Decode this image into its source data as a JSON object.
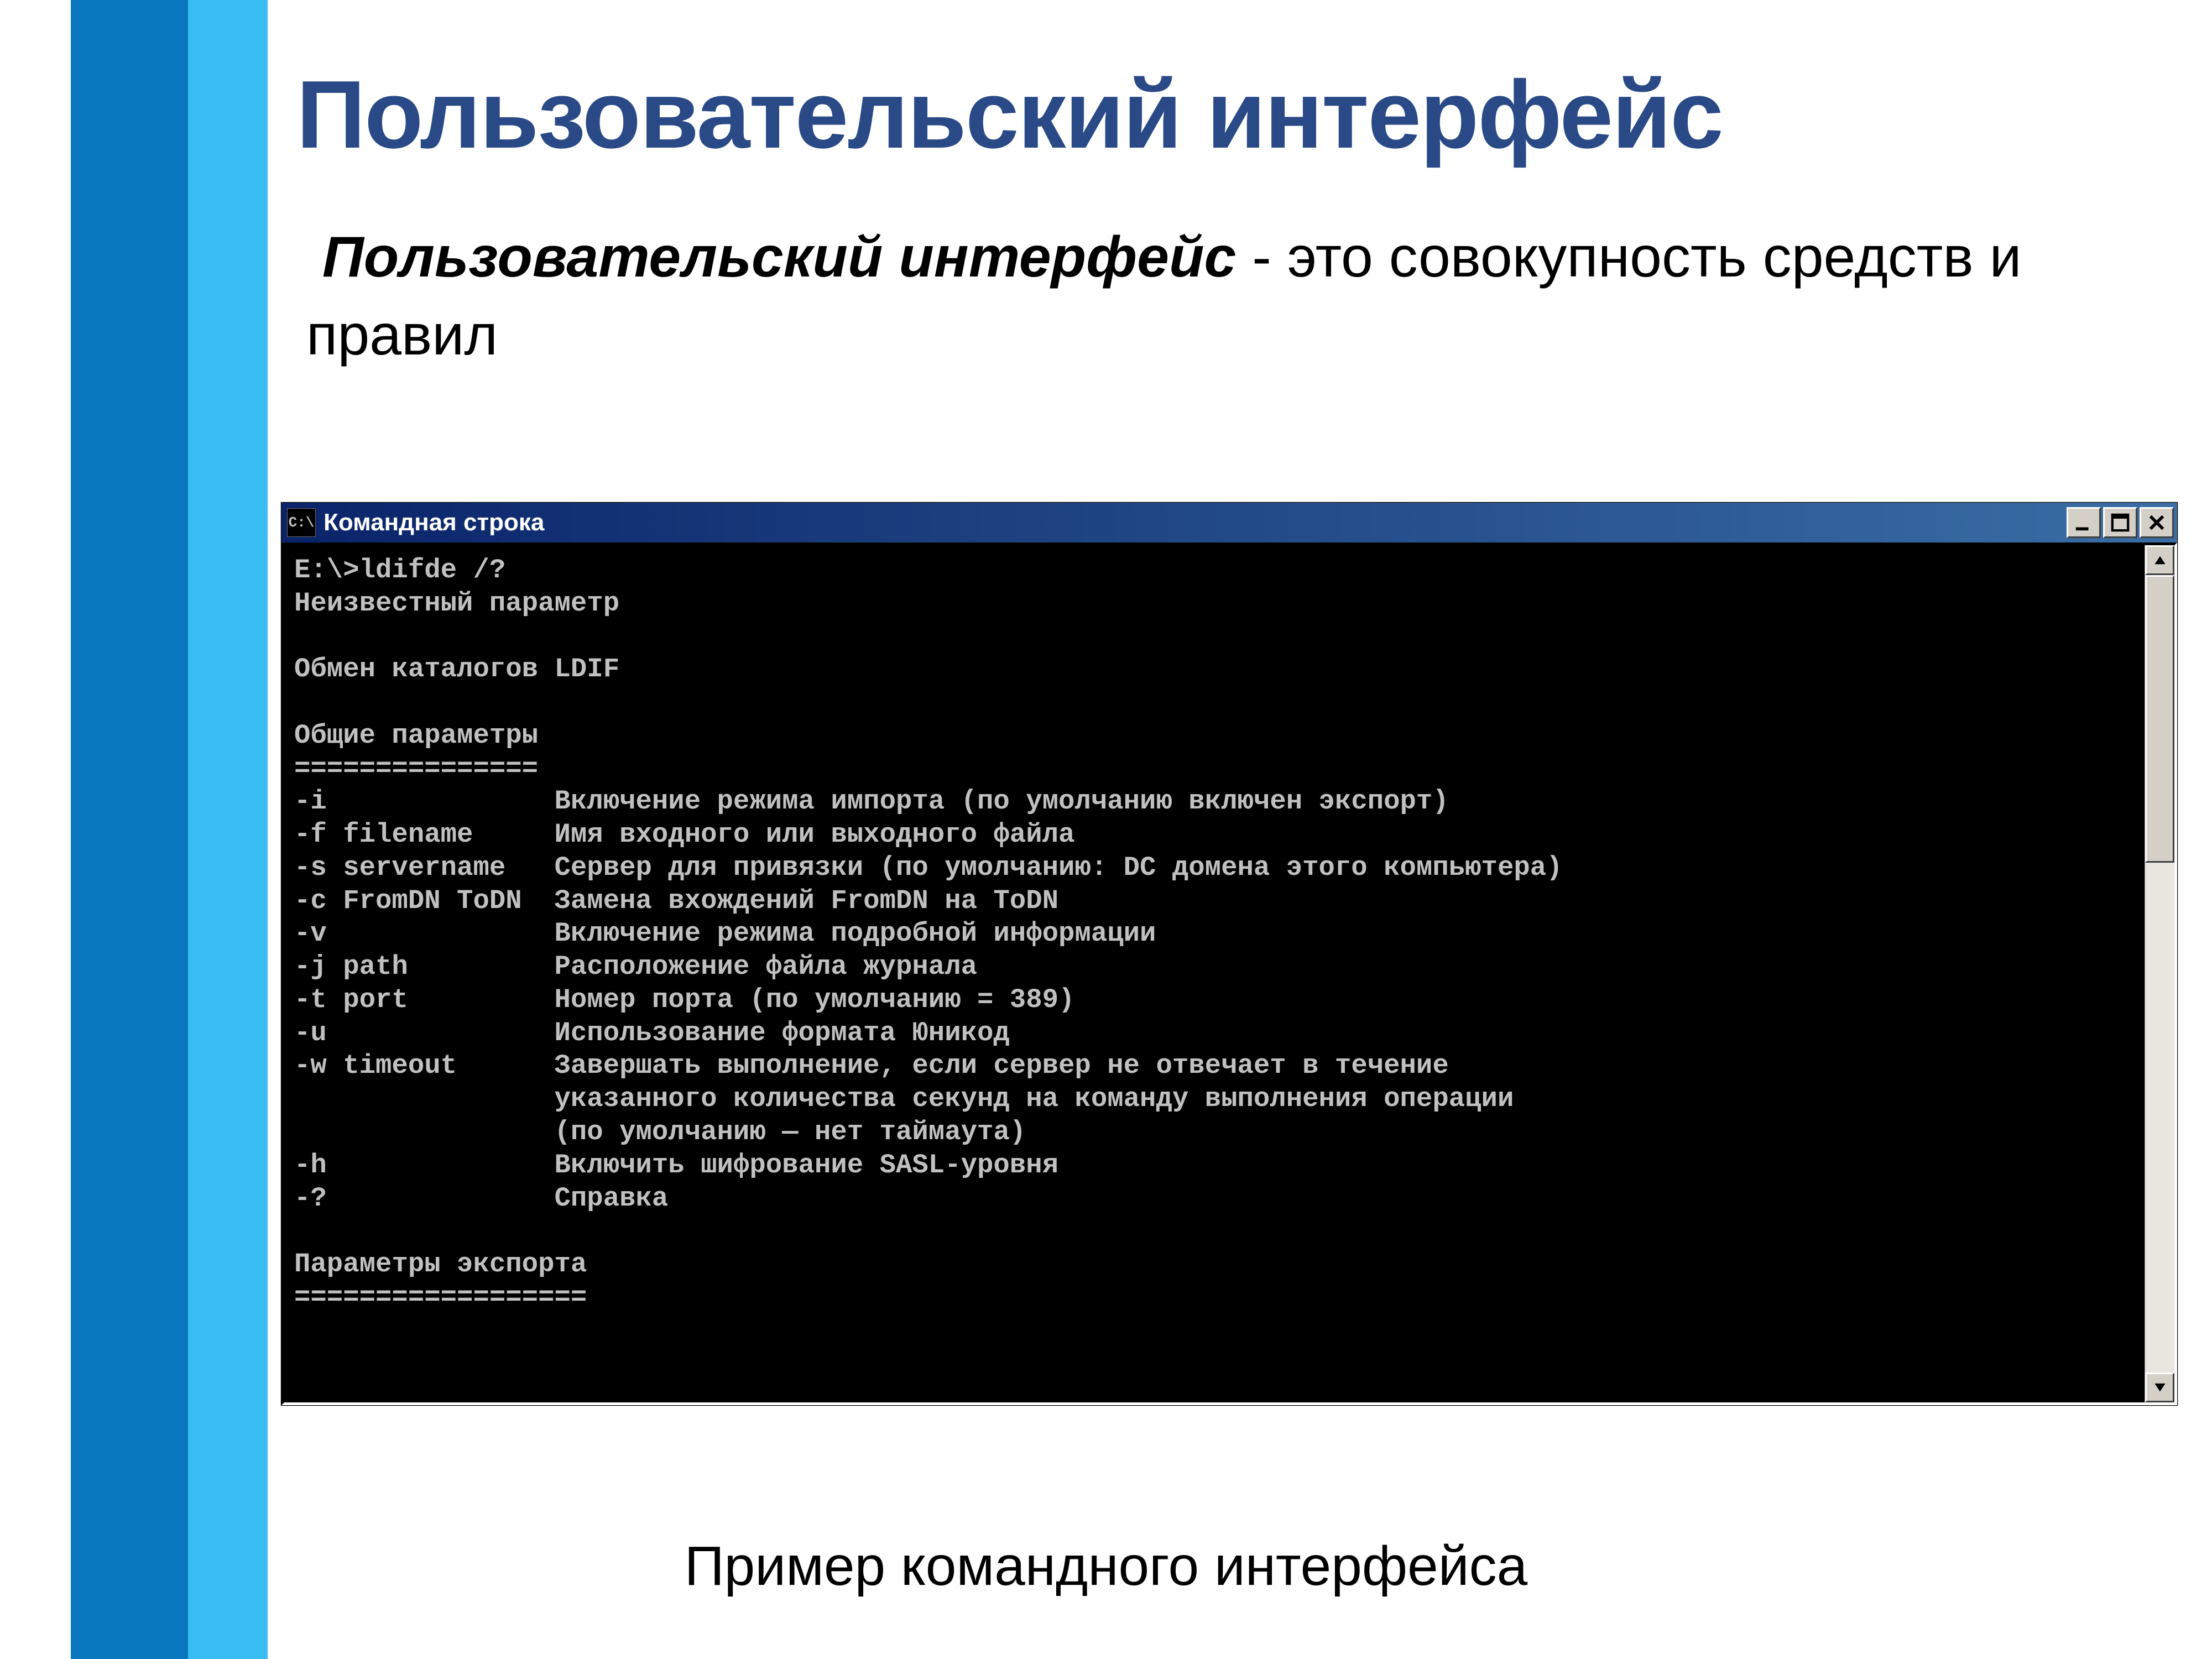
{
  "slide": {
    "title": "Пользовательский интерфейс",
    "definition_bold": "Пользовательский интерфейс",
    "definition_rest": " - это совокупность средств и правил",
    "caption": "Пример командного интерфейса"
  },
  "cmd": {
    "icon_text": "C:\\",
    "title": "Командная строка",
    "lines": [
      "E:\\>ldifde /?",
      "Неизвестный параметр",
      "",
      "Обмен каталогов LDIF",
      "",
      "Общие параметры",
      "===============",
      "-i              Включение режима импорта (по умолчанию включен экспорт)",
      "-f filename     Имя входного или выходного файла",
      "-s servername   Сервер для привязки (по умолчанию: DC домена этого компьютера)",
      "-c FromDN ToDN  Замена вхождений FromDN на ToDN",
      "-v              Включение режима подробной информации",
      "-j path         Расположение файла журнала",
      "-t port         Номер порта (по умолчанию = 389)",
      "-u              Использование формата Юникод",
      "-w timeout      Завершать выполнение, если сервер не отвечает в течение",
      "                указанного количества секунд на команду выполнения операции",
      "                (по умолчанию — нет таймаута)",
      "-h              Включить шифрование SASL-уровня",
      "-?              Справка",
      "",
      "Параметры экспорта",
      "=================="
    ]
  }
}
